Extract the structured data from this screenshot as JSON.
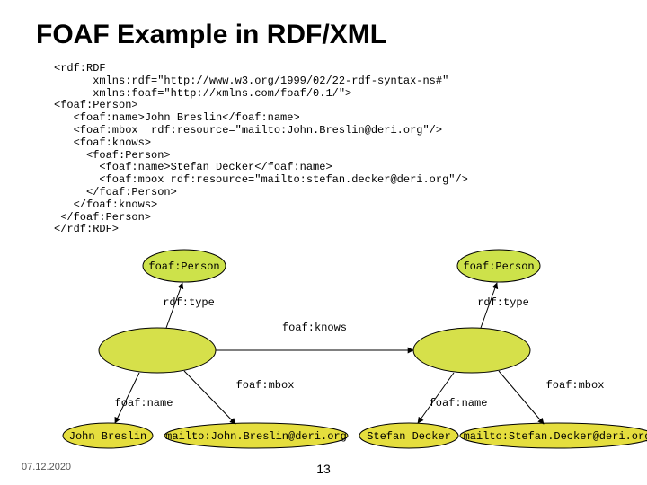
{
  "title": "FOAF Example in RDF/XML",
  "code": "<rdf:RDF\n      xmlns:rdf=\"http://www.w3.org/1999/02/22-rdf-syntax-ns#\"\n      xmlns:foaf=\"http://xmlns.com/foaf/0.1/\">\n<foaf:Person>\n   <foaf:name>John Breslin</foaf:name>\n   <foaf:mbox  rdf:resource=\"mailto:John.Breslin@deri.org\"/>\n   <foaf:knows>\n     <foaf:Person>\n       <foaf:name>Stefan Decker</foaf:name>\n       <foaf:mbox rdf:resource=\"mailto:stefan.decker@deri.org\"/>\n     </foaf:Person>\n   </foaf:knows>\n </foaf:Person>\n</rdf:RDF>",
  "footer": {
    "date": "07.12.2020",
    "page": "13"
  },
  "colors": {
    "typeNode": "#cde24a",
    "instanceNode": "#d6e04a",
    "leafNode": "#e5de3e"
  },
  "graph": {
    "types": {
      "t1": "foaf:Person",
      "t2": "foaf:Person"
    },
    "edges": {
      "type1": "rdf:type",
      "type2": "rdf:type",
      "knows": "foaf:knows",
      "name1": "foaf:name",
      "mbox1": "foaf:mbox",
      "name2": "foaf:name",
      "mbox2": "foaf:mbox"
    },
    "leaves": {
      "name1": "John Breslin",
      "mbox1": "mailto:John.Breslin@deri.org",
      "name2": "Stefan Decker",
      "mbox2": "mailto:Stefan.Decker@deri.org"
    }
  }
}
